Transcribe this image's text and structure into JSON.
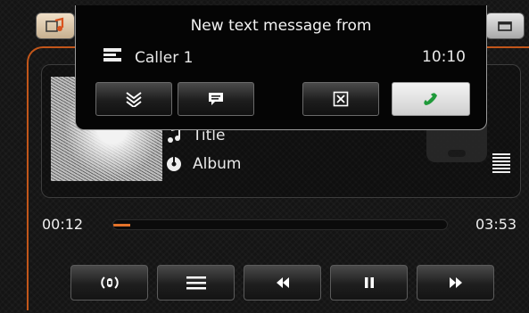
{
  "popup": {
    "title": "New text message from",
    "caller": "Caller 1",
    "time": "10:10",
    "buttons": [
      "collapse-icon",
      "message-icon",
      "close-box-icon",
      "phone-answer-icon"
    ]
  },
  "now_playing": {
    "title": "Title",
    "album": "Album"
  },
  "playback": {
    "elapsed": "00:12",
    "total": "03:53",
    "progress": 0.05
  },
  "controls": [
    "radio-icon",
    "list-icon",
    "previous-icon",
    "pause-icon",
    "next-icon"
  ],
  "colors": {
    "accent": "#c2561a",
    "progress": "#e4732a",
    "answer_icon": "#1f9a3a"
  }
}
